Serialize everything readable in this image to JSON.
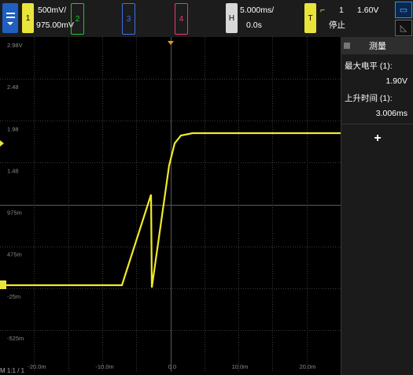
{
  "channels": [
    {
      "num": "1",
      "color": "#e8e43a",
      "scale": "500mV/",
      "offset": "975.00mV",
      "active": true
    },
    {
      "num": "2",
      "color": "#27c22f",
      "active": false
    },
    {
      "num": "3",
      "color": "#3d6fe8",
      "active": false
    },
    {
      "num": "4",
      "color": "#e8387a",
      "active": false
    }
  ],
  "horizontal": {
    "badge": "H",
    "timebase": "5.000ms/",
    "delay": "0.0s"
  },
  "trigger": {
    "badge": "T",
    "edge_icon": "rising-edge-icon",
    "source": "1",
    "level": "1.60V",
    "state": "停止"
  },
  "measurements": {
    "title": "测量",
    "items": [
      {
        "label": "最大电平 (1):",
        "value": "1.90V"
      },
      {
        "label": "上升时间 (1):",
        "value": "3.006ms"
      }
    ],
    "add_label": "+"
  },
  "y_tick_labels": [
    "2.98V",
    "2.48",
    "1.98",
    "1.48",
    "975m",
    "475m",
    "-25m",
    "-525m"
  ],
  "x_tick_labels": [
    "-20.0m",
    "-10.0m",
    "0.0",
    "10.0m",
    "20.0m"
  ],
  "bottom_text": "M 1:1 / 1",
  "colors": {
    "trace": "#f0ea28",
    "grid": "#4a4a4a",
    "accent": "#1f5fbf"
  }
}
